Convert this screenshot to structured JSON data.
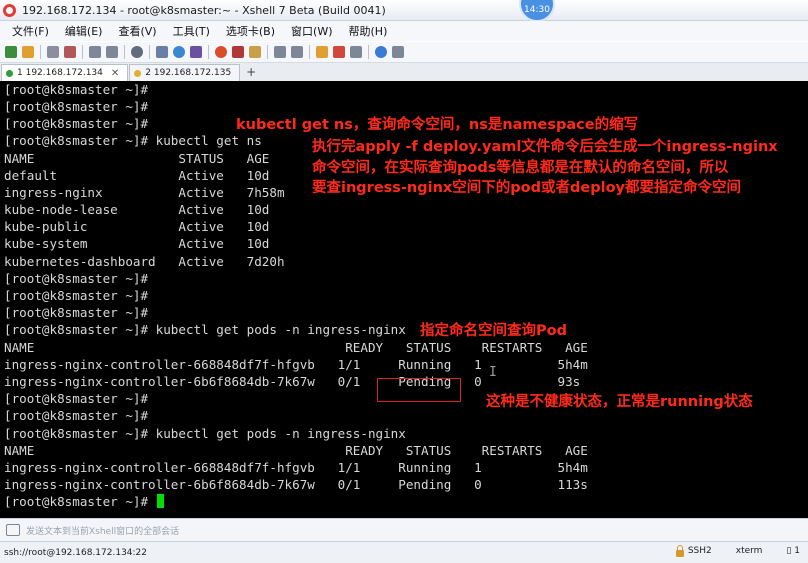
{
  "window": {
    "title": "192.168.172.134 - root@k8smaster:~ - Xshell 7 Beta (Build 0041)",
    "clock_badge": "14:30"
  },
  "menu": [
    "文件(F)",
    "编辑(E)",
    "查看(V)",
    "工具(T)",
    "选项卡(B)",
    "窗口(W)",
    "帮助(H)"
  ],
  "tabs": [
    {
      "label": "1 192.168.172.134",
      "status_color": "#2e9e3a",
      "active": true
    },
    {
      "label": "2 192.168.172.135",
      "status_color": "#e0b030",
      "active": false
    }
  ],
  "terminal": {
    "lines": [
      "[root@k8smaster ~]#",
      "[root@k8smaster ~]#",
      "[root@k8smaster ~]#",
      "[root@k8smaster ~]# kubectl get ns",
      "NAME                   STATUS   AGE",
      "default                Active   10d",
      "ingress-nginx          Active   7h58m",
      "kube-node-lease        Active   10d",
      "kube-public            Active   10d",
      "kube-system            Active   10d",
      "kubernetes-dashboard   Active   7d20h",
      "[root@k8smaster ~]#",
      "[root@k8smaster ~]#",
      "[root@k8smaster ~]#",
      "[root@k8smaster ~]# kubectl get pods -n ingress-nginx",
      "NAME                                         READY   STATUS    RESTARTS   AGE",
      "ingress-nginx-controller-668848df7f-hfgvb   1/1     Running   1          5h4m",
      "ingress-nginx-controller-6b6f8684db-7k67w   0/1     Pending   0          93s",
      "[root@k8smaster ~]#",
      "[root@k8smaster ~]#",
      "[root@k8smaster ~]# kubectl get pods -n ingress-nginx",
      "NAME                                         READY   STATUS    RESTARTS   AGE",
      "ingress-nginx-controller-668848df7f-hfgvb   1/1     Running   1          5h4m",
      "ingress-nginx-controller-6b6f8684db-7k67w   0/1     Pending   0          113s",
      "[root@k8smaster ~]# "
    ]
  },
  "annotations": {
    "ns_note": "kubectl get ns，查询命令空间，ns是namespace的缩写",
    "apply_note_1": "执行完apply -f deploy.yaml文件命令后会生成一个ingress-nginx",
    "apply_note_2": "命令空间，在实际查询pods等信息都是在默认的命名空间，所以",
    "apply_note_3": "要查ingress-nginx空间下的pod或者deploy都要指定命令空间",
    "pod_note": "指定命名空间查询Pod",
    "status_note": "这种是不健康状态，正常是running状态",
    "color": "#ff2a1a"
  },
  "input_bar": {
    "placeholder": "发送文本到当前Xshell窗口的全部会话"
  },
  "statusbar": {
    "connection": "ssh://root@192.168.172.134:22",
    "protocol": "SSH2",
    "terminal_type": "xterm",
    "size": "▯ 1"
  }
}
